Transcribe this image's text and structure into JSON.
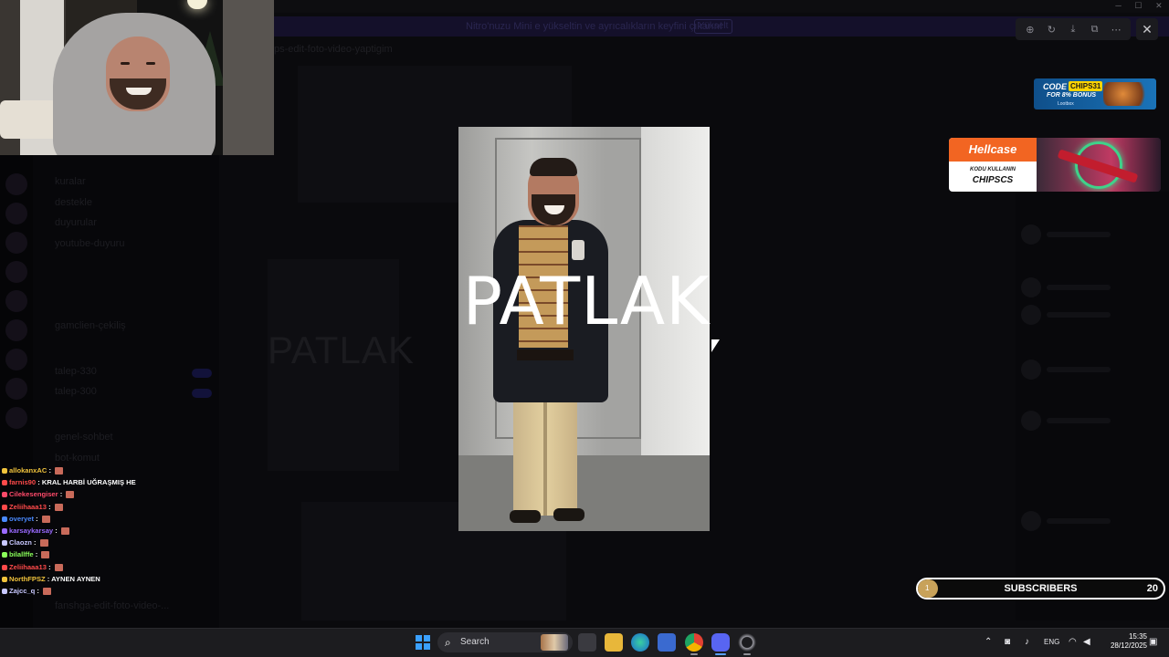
{
  "background_app": {
    "banner_text": "Nitro'nuzu Mini e yükseltin ve ayrıcalıkların keyfini çıkarın!",
    "banner_button": "Yükselt",
    "channel_header": "ps-edit-foto-video-yaptigim",
    "channels": [
      "kuralar",
      "destekle",
      "duyurular",
      "youtube-duyuru",
      "gamclien-çekiliş",
      "talep-330",
      "talep-300",
      "genel-sohbet",
      "bot-komut",
      "fanshga-edit-foto-video-..."
    ],
    "ghost_text": "PATLAK"
  },
  "viewer": {
    "toolbar_icons": [
      "zoom-icon",
      "rotate-icon",
      "download-icon",
      "open-external-icon",
      "more-icon"
    ],
    "close_label": "✕",
    "image_caption": "PATLAK"
  },
  "ads": {
    "chips": {
      "code_label": "CODE",
      "code_value": "CHIPS31",
      "bonus": "FOR 8% BONUS",
      "brand": "Lootbox"
    },
    "hellcase": {
      "brand": "Hellcase",
      "note": "KODU KULLANIN",
      "code": "CHIPSCS"
    }
  },
  "chat": [
    {
      "user": "allokanxAC",
      "color": "#f0c33c",
      "message": ""
    },
    {
      "user": "farnis90",
      "color": "#ff4a4a",
      "message": "KRAL HARBİ UĞRAŞMIŞ HE"
    },
    {
      "user": "Cilekesengiser",
      "color": "#ff4a6a",
      "message": ""
    },
    {
      "user": "Zeliihaaa13",
      "color": "#ff4a4a",
      "message": ""
    },
    {
      "user": "overyet",
      "color": "#4a8aff",
      "message": ""
    },
    {
      "user": "karsaykarsay",
      "color": "#9a6aff",
      "message": ""
    },
    {
      "user": "Claozn",
      "color": "#c8c8ff",
      "message": ""
    },
    {
      "user": "bilallffe",
      "color": "#8aff5a",
      "message": ""
    },
    {
      "user": "Zeliihaaa13",
      "color": "#ff4a4a",
      "message": ""
    },
    {
      "user": "NorthFPSZ",
      "color": "#f0c33c",
      "message": "AYNEN AYNEN"
    },
    {
      "user": "Zajcc_q",
      "color": "#c8c8ff",
      "message": ""
    }
  ],
  "subscribers": {
    "current": "1",
    "label": "SUBSCRIBERS",
    "goal": "20",
    "progress": 0.05
  },
  "taskbar": {
    "search_placeholder": "Search",
    "language": "ENG",
    "time": "15:35",
    "date": "28/12/2025"
  },
  "colors": {
    "accent": "#3aa0ff",
    "hellcase": "#f26522",
    "subs_fill": "#c8a25a"
  }
}
